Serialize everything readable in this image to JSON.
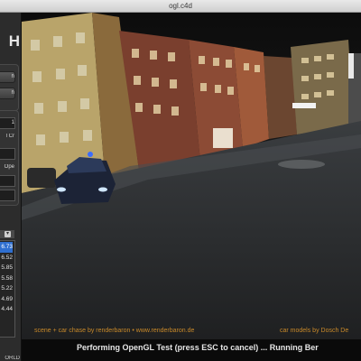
{
  "window": {
    "title": "ogl.c4d"
  },
  "sidebar": {
    "logo_text": "H",
    "buttons": [
      {
        "label": "h"
      },
      {
        "label": "h"
      }
    ],
    "processor_field": "1",
    "renderer_label": "l Cr",
    "opengl_label": "Ope",
    "results": [
      "6.73",
      "6.52",
      "5.85",
      "5.58",
      "5.22",
      "4.69",
      "4.44"
    ],
    "selected_index": 0,
    "footer_label": "ORLD"
  },
  "scene": {
    "credit_left": "scene + car chase by renderbaron • www.renderbaron.de",
    "credit_right": "car models by Dosch De",
    "status": "Performing OpenGL Test (press ESC to cancel) ... Running Ber"
  },
  "colors": {
    "selection": "#2f6fd0",
    "credit_text": "#c8892a",
    "headlight": "#cfe6ff"
  }
}
